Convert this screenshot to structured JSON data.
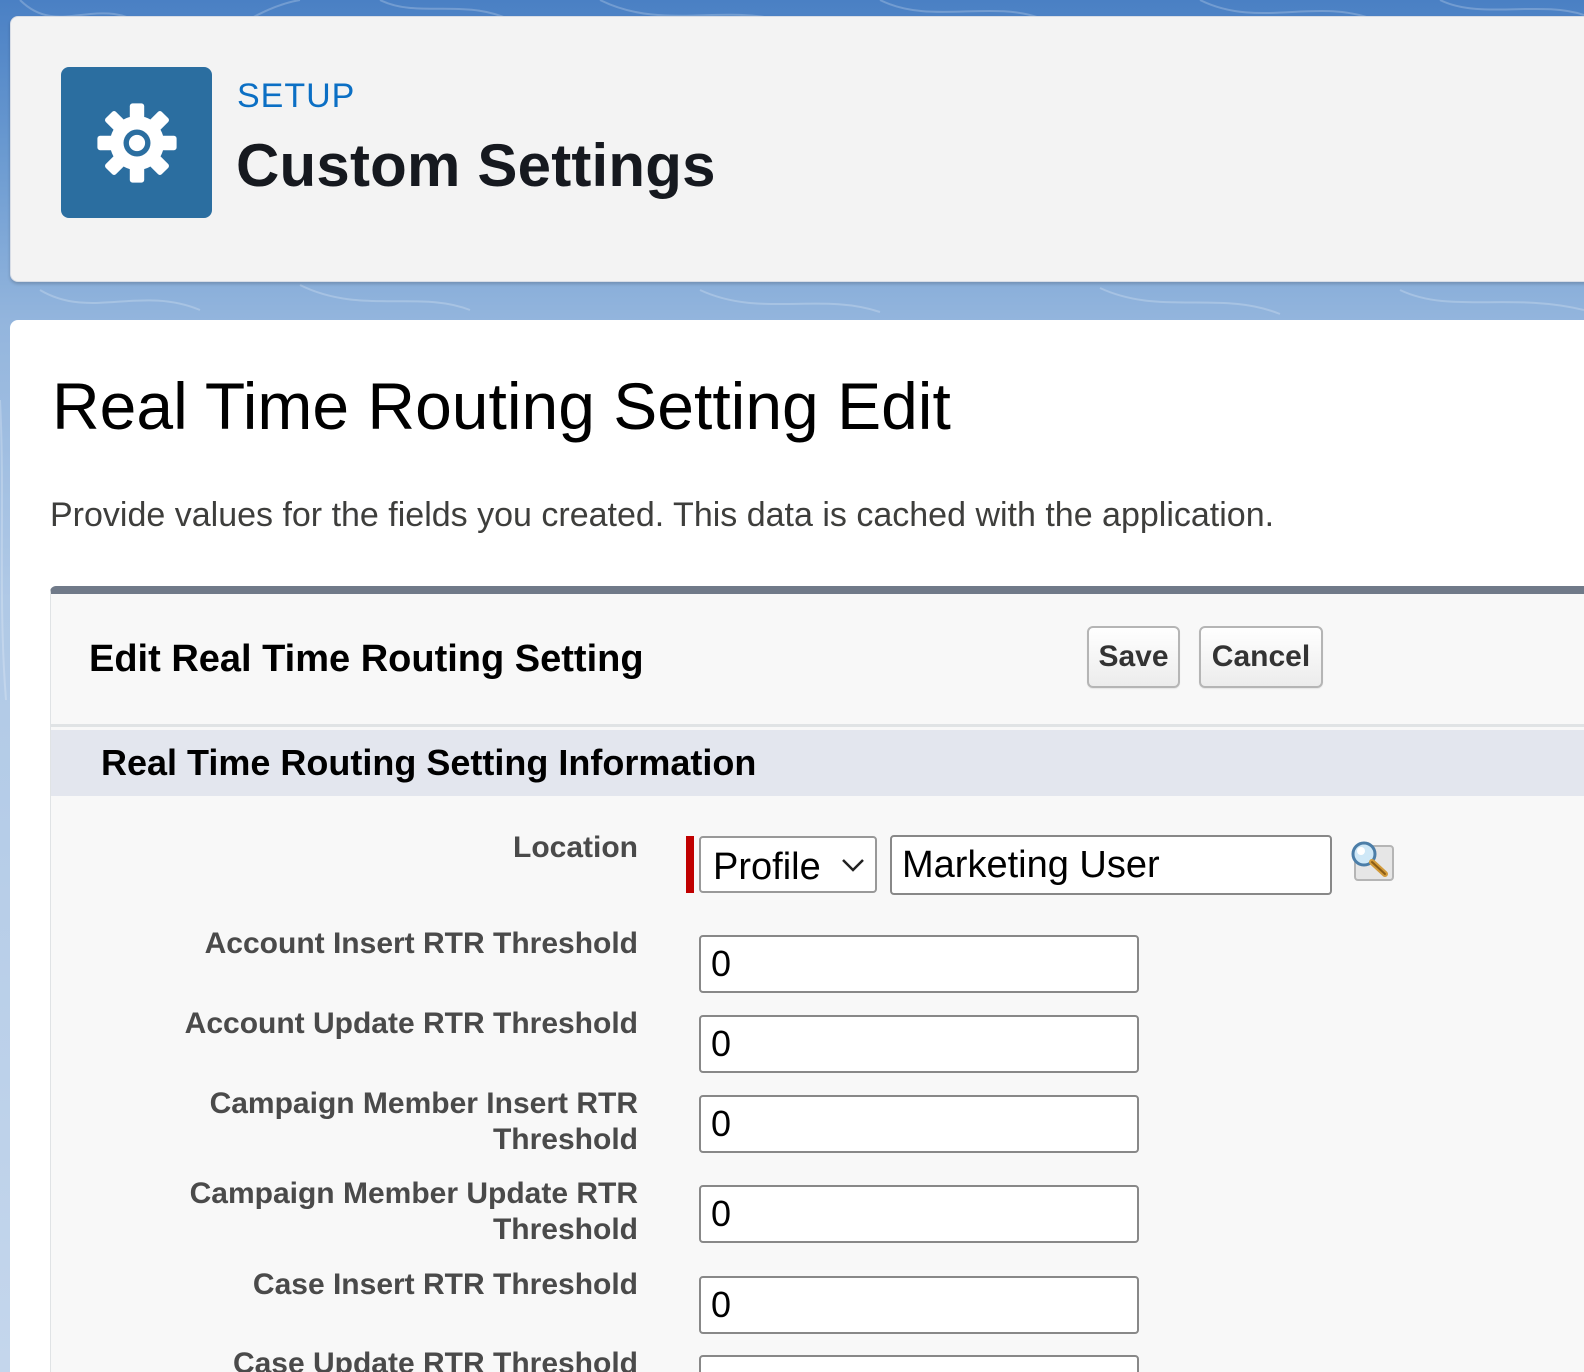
{
  "header": {
    "eyebrow": "SETUP",
    "title": "Custom Settings",
    "icon": "gear-icon"
  },
  "page": {
    "title": "Real Time Routing Setting Edit",
    "description": "Provide values for the fields you created. This data is cached with the application."
  },
  "edit_block": {
    "title": "Edit Real Time Routing Setting",
    "save_label": "Save",
    "cancel_label": "Cancel"
  },
  "section": {
    "title": "Real Time Routing Setting Information"
  },
  "location": {
    "label": "Location",
    "type_selected": "Profile",
    "value": "Marketing User",
    "lookup_icon": "lookup-magnifier-icon"
  },
  "fields": [
    {
      "label": "Account Insert RTR Threshold",
      "value": "0"
    },
    {
      "label": "Account Update RTR Threshold",
      "value": "0"
    },
    {
      "label_line1": "Campaign Member Insert RTR",
      "label_line2": "Threshold",
      "value": "0"
    },
    {
      "label_line1": "Campaign Member Update RTR",
      "label_line2": "Threshold",
      "value": "0"
    },
    {
      "label": "Case Insert RTR Threshold",
      "value": "0"
    },
    {
      "label": "Case Update RTR Threshold",
      "value": ""
    }
  ],
  "colors": {
    "icon_bg": "#2b6ea0",
    "eyebrow": "#0b6fc4",
    "required": "#c00000",
    "block_top_border": "#707a89",
    "section_bg": "#e3e6ee"
  }
}
